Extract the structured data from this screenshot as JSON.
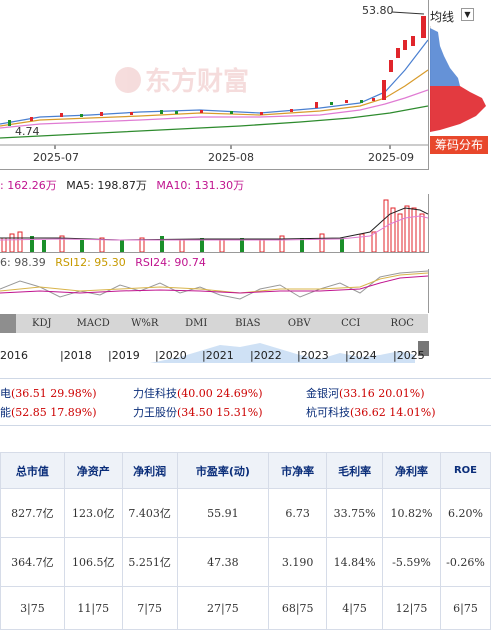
{
  "chart": {
    "watermark": "东方财富",
    "price_label": "53.80",
    "left_low_label": "4.74",
    "dates": [
      "2025-07",
      "2025-08",
      "2025-09"
    ],
    "dropdown_label": "均线",
    "chip_button_label": "筹码分布",
    "colors": {
      "up": "#e0252b",
      "down": "#1a8f2a",
      "ma5": "#e07bd3",
      "ma10": "#d89b2b",
      "ma20": "#4a7fd0",
      "ma60": "#2e8b2e"
    }
  },
  "volume_legend": {
    "vol": ": 162.26万",
    "ma5": "MA5: 198.87万",
    "ma10": "MA10: 131.30万"
  },
  "rsi_legend": {
    "rsi6": "6: 98.39",
    "rsi12": "RSI12: 95.30",
    "rsi24": "RSI24: 90.74"
  },
  "indicator_tabs": [
    "KDJ",
    "MACD",
    "W%R",
    "DMI",
    "BIAS",
    "OBV",
    "CCI",
    "ROC"
  ],
  "timeline_years": [
    "2016",
    "|2018",
    "|2019",
    "|2020",
    "|2021",
    "|2022",
    "|2023",
    "|2024",
    "|2025"
  ],
  "related": [
    {
      "name": "电",
      "value": "(36.51 29.98%)"
    },
    {
      "name": "力佳科技",
      "value": "(40.00 24.69%)"
    },
    {
      "name": "金银河",
      "value": "(33.16 20.01%)"
    },
    {
      "name": "能",
      "value": "(52.85 17.89%)"
    },
    {
      "name": "力王股份",
      "value": "(34.50 15.31%)"
    },
    {
      "name": "杭可科技",
      "value": "(36.62 14.01%)"
    }
  ],
  "table": {
    "headers": [
      "总市值",
      "净资产",
      "净利润",
      "市盈率(动)",
      "市净率",
      "毛利率",
      "净利率",
      "ROE"
    ],
    "rows": [
      [
        "827.7亿",
        "123.0亿",
        "7.403亿",
        "55.91",
        "6.73",
        "33.75%",
        "10.82%",
        "6.20%"
      ],
      [
        "364.7亿",
        "106.5亿",
        "5.251亿",
        "47.38",
        "3.190",
        "14.84%",
        "-5.59%",
        "-0.26%"
      ],
      [
        "3|75",
        "11|75",
        "7|75",
        "27|75",
        "68|75",
        "4|75",
        "12|75",
        "6|75"
      ]
    ]
  }
}
